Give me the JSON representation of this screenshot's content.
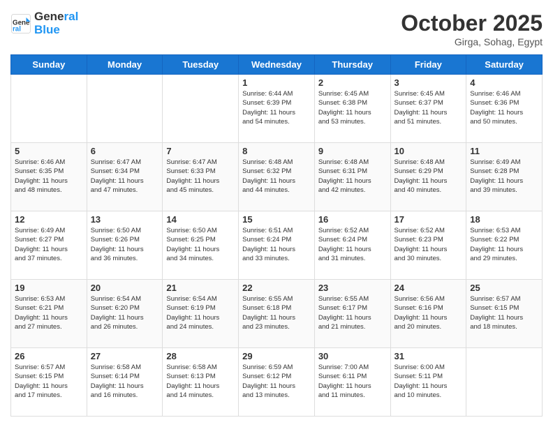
{
  "header": {
    "logo_line1": "General",
    "logo_line2": "Blue",
    "month_title": "October 2025",
    "location": "Girga, Sohag, Egypt"
  },
  "weekdays": [
    "Sunday",
    "Monday",
    "Tuesday",
    "Wednesday",
    "Thursday",
    "Friday",
    "Saturday"
  ],
  "weeks": [
    [
      {
        "day": "",
        "info": ""
      },
      {
        "day": "",
        "info": ""
      },
      {
        "day": "",
        "info": ""
      },
      {
        "day": "1",
        "info": "Sunrise: 6:44 AM\nSunset: 6:39 PM\nDaylight: 11 hours\nand 54 minutes."
      },
      {
        "day": "2",
        "info": "Sunrise: 6:45 AM\nSunset: 6:38 PM\nDaylight: 11 hours\nand 53 minutes."
      },
      {
        "day": "3",
        "info": "Sunrise: 6:45 AM\nSunset: 6:37 PM\nDaylight: 11 hours\nand 51 minutes."
      },
      {
        "day": "4",
        "info": "Sunrise: 6:46 AM\nSunset: 6:36 PM\nDaylight: 11 hours\nand 50 minutes."
      }
    ],
    [
      {
        "day": "5",
        "info": "Sunrise: 6:46 AM\nSunset: 6:35 PM\nDaylight: 11 hours\nand 48 minutes."
      },
      {
        "day": "6",
        "info": "Sunrise: 6:47 AM\nSunset: 6:34 PM\nDaylight: 11 hours\nand 47 minutes."
      },
      {
        "day": "7",
        "info": "Sunrise: 6:47 AM\nSunset: 6:33 PM\nDaylight: 11 hours\nand 45 minutes."
      },
      {
        "day": "8",
        "info": "Sunrise: 6:48 AM\nSunset: 6:32 PM\nDaylight: 11 hours\nand 44 minutes."
      },
      {
        "day": "9",
        "info": "Sunrise: 6:48 AM\nSunset: 6:31 PM\nDaylight: 11 hours\nand 42 minutes."
      },
      {
        "day": "10",
        "info": "Sunrise: 6:48 AM\nSunset: 6:29 PM\nDaylight: 11 hours\nand 40 minutes."
      },
      {
        "day": "11",
        "info": "Sunrise: 6:49 AM\nSunset: 6:28 PM\nDaylight: 11 hours\nand 39 minutes."
      }
    ],
    [
      {
        "day": "12",
        "info": "Sunrise: 6:49 AM\nSunset: 6:27 PM\nDaylight: 11 hours\nand 37 minutes."
      },
      {
        "day": "13",
        "info": "Sunrise: 6:50 AM\nSunset: 6:26 PM\nDaylight: 11 hours\nand 36 minutes."
      },
      {
        "day": "14",
        "info": "Sunrise: 6:50 AM\nSunset: 6:25 PM\nDaylight: 11 hours\nand 34 minutes."
      },
      {
        "day": "15",
        "info": "Sunrise: 6:51 AM\nSunset: 6:24 PM\nDaylight: 11 hours\nand 33 minutes."
      },
      {
        "day": "16",
        "info": "Sunrise: 6:52 AM\nSunset: 6:24 PM\nDaylight: 11 hours\nand 31 minutes."
      },
      {
        "day": "17",
        "info": "Sunrise: 6:52 AM\nSunset: 6:23 PM\nDaylight: 11 hours\nand 30 minutes."
      },
      {
        "day": "18",
        "info": "Sunrise: 6:53 AM\nSunset: 6:22 PM\nDaylight: 11 hours\nand 29 minutes."
      }
    ],
    [
      {
        "day": "19",
        "info": "Sunrise: 6:53 AM\nSunset: 6:21 PM\nDaylight: 11 hours\nand 27 minutes."
      },
      {
        "day": "20",
        "info": "Sunrise: 6:54 AM\nSunset: 6:20 PM\nDaylight: 11 hours\nand 26 minutes."
      },
      {
        "day": "21",
        "info": "Sunrise: 6:54 AM\nSunset: 6:19 PM\nDaylight: 11 hours\nand 24 minutes."
      },
      {
        "day": "22",
        "info": "Sunrise: 6:55 AM\nSunset: 6:18 PM\nDaylight: 11 hours\nand 23 minutes."
      },
      {
        "day": "23",
        "info": "Sunrise: 6:55 AM\nSunset: 6:17 PM\nDaylight: 11 hours\nand 21 minutes."
      },
      {
        "day": "24",
        "info": "Sunrise: 6:56 AM\nSunset: 6:16 PM\nDaylight: 11 hours\nand 20 minutes."
      },
      {
        "day": "25",
        "info": "Sunrise: 6:57 AM\nSunset: 6:15 PM\nDaylight: 11 hours\nand 18 minutes."
      }
    ],
    [
      {
        "day": "26",
        "info": "Sunrise: 6:57 AM\nSunset: 6:15 PM\nDaylight: 11 hours\nand 17 minutes."
      },
      {
        "day": "27",
        "info": "Sunrise: 6:58 AM\nSunset: 6:14 PM\nDaylight: 11 hours\nand 16 minutes."
      },
      {
        "day": "28",
        "info": "Sunrise: 6:58 AM\nSunset: 6:13 PM\nDaylight: 11 hours\nand 14 minutes."
      },
      {
        "day": "29",
        "info": "Sunrise: 6:59 AM\nSunset: 6:12 PM\nDaylight: 11 hours\nand 13 minutes."
      },
      {
        "day": "30",
        "info": "Sunrise: 7:00 AM\nSunset: 6:11 PM\nDaylight: 11 hours\nand 11 minutes."
      },
      {
        "day": "31",
        "info": "Sunrise: 6:00 AM\nSunset: 5:11 PM\nDaylight: 11 hours\nand 10 minutes."
      },
      {
        "day": "",
        "info": ""
      }
    ]
  ]
}
